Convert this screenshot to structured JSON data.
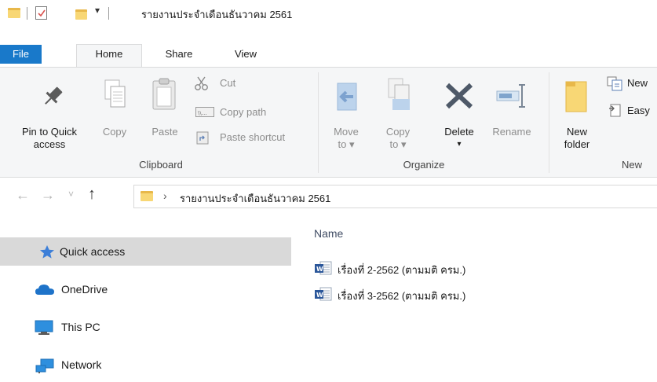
{
  "window": {
    "title": "รายงานประจำเดือนธันวาคม 2561",
    "qat_dropdown": "▾"
  },
  "tabs": [
    {
      "label": "File"
    },
    {
      "label": "Home"
    },
    {
      "label": "Share"
    },
    {
      "label": "View"
    }
  ],
  "ribbon": {
    "clipboard": {
      "pin": "Pin to Quick access",
      "pin_line1": "Pin to Quick",
      "pin_line2": "access",
      "copy": "Copy",
      "paste": "Paste",
      "cut": "Cut",
      "copy_path": "Copy path",
      "paste_shortcut": "Paste shortcut",
      "group": "Clipboard"
    },
    "organize": {
      "move_to_line1": "Move",
      "move_to_line2": "to ▾",
      "copy_to_line1": "Copy",
      "copy_to_line2": "to ▾",
      "delete": "Delete",
      "delete_arrow": "▾",
      "rename": "Rename",
      "group": "Organize"
    },
    "new": {
      "new_folder_line1": "New",
      "new_folder_line2": "folder",
      "new_item": "New",
      "easy_access": "Easy",
      "group": "New"
    }
  },
  "address": {
    "back": "←",
    "forward": "→",
    "recent": "˅",
    "up": "↑",
    "chevron": "›",
    "path": "รายงานประจำเดือนธันวาคม 2561"
  },
  "nav": [
    {
      "label": "Quick access",
      "icon": "star-icon",
      "selected": true
    },
    {
      "label": "OneDrive",
      "icon": "cloud-icon",
      "selected": false
    },
    {
      "label": "This PC",
      "icon": "monitor-icon",
      "selected": false
    },
    {
      "label": "Network",
      "icon": "network-icon",
      "selected": false
    }
  ],
  "files": {
    "column_name": "Name",
    "items": [
      {
        "name": "เรื่องที่ 2-2562 (ตามมติ ครม.)",
        "icon": "word-document-icon"
      },
      {
        "name": "เรื่องที่ 3-2562 (ตามมติ ครม.)",
        "icon": "word-document-icon"
      }
    ]
  },
  "colors": {
    "file_tab": "#1979ca",
    "ribbon_bg": "#f5f6f7",
    "selection": "#d9d9d9",
    "folder": "#f8d775",
    "word_blue": "#2b579a",
    "quick_access_star": "#3d7fd8"
  }
}
